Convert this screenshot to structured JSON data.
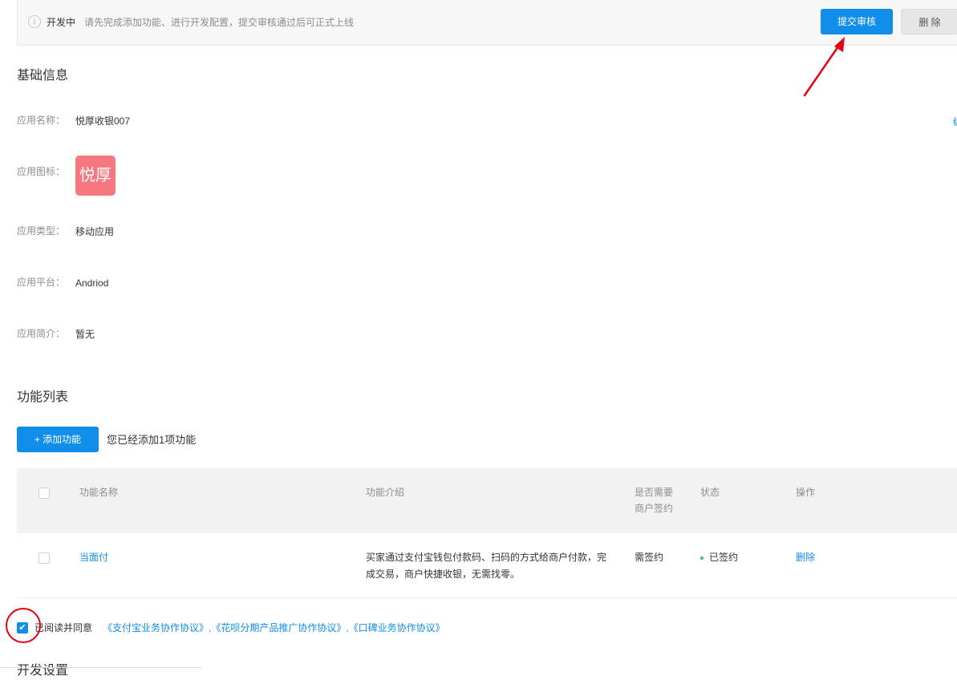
{
  "notice": {
    "icon": "info-icon",
    "icon_glyph": "i",
    "status": "开发中",
    "message": "请先完成添加功能、进行开发配置，提交审核通过后可正式上线",
    "submit_label": "提交审核",
    "delete_label": "删 除"
  },
  "basic_info": {
    "title": "基础信息",
    "fields": [
      {
        "label": "应用名称：",
        "value": "悦厚收银007"
      },
      {
        "label": "应用图标：",
        "logo_text": "悦厚"
      },
      {
        "label": "应用类型：",
        "value": "移动应用"
      },
      {
        "label": "应用平台：",
        "value": "Andriod"
      },
      {
        "label": "应用简介：",
        "value": "暂无"
      }
    ],
    "edge_link": "编"
  },
  "features": {
    "title": "功能列表",
    "add_button_label": "+ 添加功能",
    "count_text": "您已经添加1项功能",
    "table": {
      "headers": [
        "功能名称",
        "功能介绍",
        "是否需要商户签约",
        "状态",
        "操作"
      ],
      "rows": [
        {
          "name": "当面付",
          "description": "买家通过支付宝钱包付款码、扫码的方式给商户付款，完成交易，商户快捷收银，无需找零。",
          "sign_required": "需签约",
          "status": "已签约",
          "status_color": "#3cbf5c",
          "action": "删除"
        }
      ]
    }
  },
  "agreement": {
    "checked": true,
    "checkmark": "✔",
    "label": "已阅读并同意",
    "links_text": "《支付宝业务协作协议》,《花呗分期产品推广协作协议》,《口碑业务协作协议》"
  },
  "next_section_title": "开发设置",
  "colors": {
    "primary": "#108ee9",
    "annotation_red": "#e60012",
    "logo_bg": "#f6787e"
  }
}
